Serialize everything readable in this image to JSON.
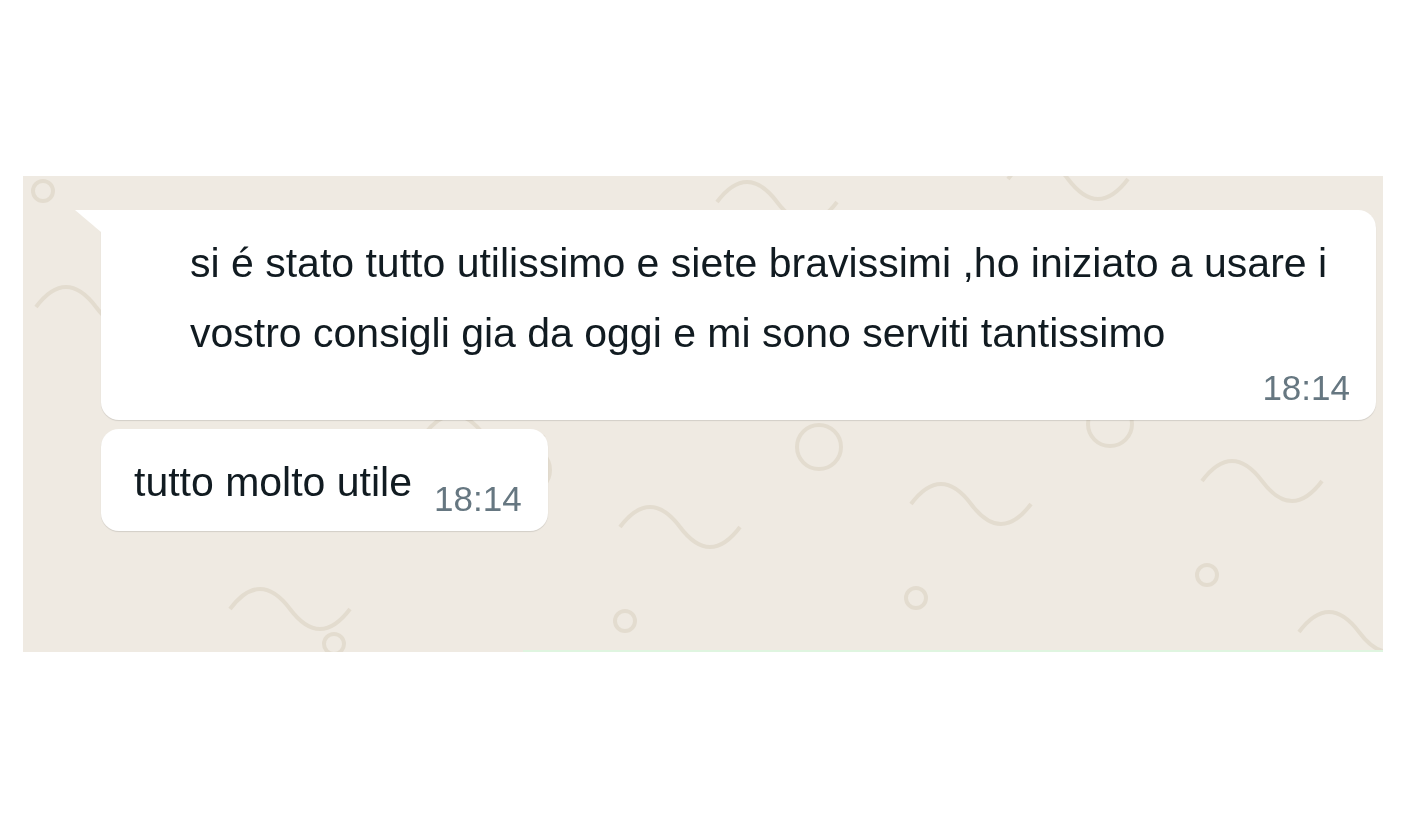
{
  "chat": {
    "messages": [
      {
        "text": "si é stato tutto utilissimo e siete bravissimi ,ho iniziato a usare i vostro consigli gia da oggi e mi sono serviti tantissimo",
        "time": "18:14",
        "tail": true
      },
      {
        "text": "tutto molto utile",
        "time": "18:14",
        "tail": false
      }
    ]
  }
}
